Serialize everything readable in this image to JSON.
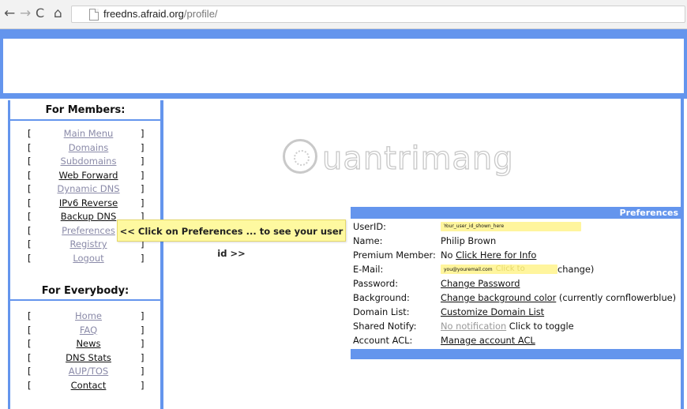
{
  "browser": {
    "url_host": "freedns.afraid.org",
    "url_path": "/profile/",
    "back_glyph": "←",
    "forward_glyph": "→",
    "reload_glyph": "C",
    "home_glyph": "⌂"
  },
  "sidebar": {
    "members_title": "For Members:",
    "members_items": [
      {
        "label": "Main Menu",
        "bracket_open": "[",
        "bracket_close": "]"
      },
      {
        "label": "Domains",
        "bracket_open": "[",
        "bracket_close": "]"
      },
      {
        "label": "Subdomains",
        "bracket_open": "[",
        "bracket_close": "]"
      },
      {
        "label": "Web Forward",
        "bracket_open": "[",
        "bracket_close": "]"
      },
      {
        "label": "Dynamic DNS",
        "bracket_open": "[",
        "bracket_close": "]"
      },
      {
        "label": "IPv6 Reverse",
        "bracket_open": "[",
        "bracket_close": "]"
      },
      {
        "label": "Backup DNS",
        "bracket_open": "[",
        "bracket_close": "]"
      },
      {
        "label": "Preferences",
        "bracket_open": "[",
        "bracket_close": "]"
      },
      {
        "label": "Registry",
        "bracket_open": "[",
        "bracket_close": "]"
      },
      {
        "label": "Logout",
        "bracket_open": "[",
        "bracket_close": "]"
      }
    ],
    "everybody_title": "For Everybody:",
    "everybody_items": [
      {
        "label": "Home",
        "bracket_open": "[",
        "bracket_close": "]"
      },
      {
        "label": "FAQ",
        "bracket_open": "[",
        "bracket_close": "]"
      },
      {
        "label": "News",
        "bracket_open": "[",
        "bracket_close": "]"
      },
      {
        "label": "DNS Stats",
        "bracket_open": "[",
        "bracket_close": "]"
      },
      {
        "label": "AUP/TOS",
        "bracket_open": "[",
        "bracket_close": "]"
      },
      {
        "label": "Contact",
        "bracket_open": "[",
        "bracket_close": "]"
      }
    ]
  },
  "watermark": {
    "text": "uantrimang"
  },
  "callout": {
    "text": "<< Click on Preferences ... to see your user id >>"
  },
  "preferences": {
    "title": "Preferences",
    "rows": {
      "userid": {
        "label": "UserID:",
        "value": "Your_user_id_shown_here"
      },
      "name": {
        "label": "Name:",
        "value": "Philip Brown"
      },
      "premium": {
        "label": "Premium Member:",
        "prefix": "No",
        "link": "Click Here for Info"
      },
      "email": {
        "label": "E-Mail:",
        "value": "you@youremail.com",
        "ghost": "Click to",
        "suffix": "change)"
      },
      "password": {
        "label": "Password:",
        "link": "Change Password"
      },
      "background": {
        "label": "Background:",
        "link": "Change background color",
        "suffix": "(currently cornflowerblue)"
      },
      "domainlist": {
        "label": "Domain List:",
        "link": "Customize Domain List"
      },
      "sharednotify": {
        "label": "Shared Notify:",
        "link": "No notification",
        "suffix": "Click to toggle"
      },
      "acl": {
        "label": "Account ACL:",
        "link": "Manage account ACL"
      }
    }
  },
  "colors": {
    "accent": "#6495ed",
    "highlight": "#fff59d"
  }
}
